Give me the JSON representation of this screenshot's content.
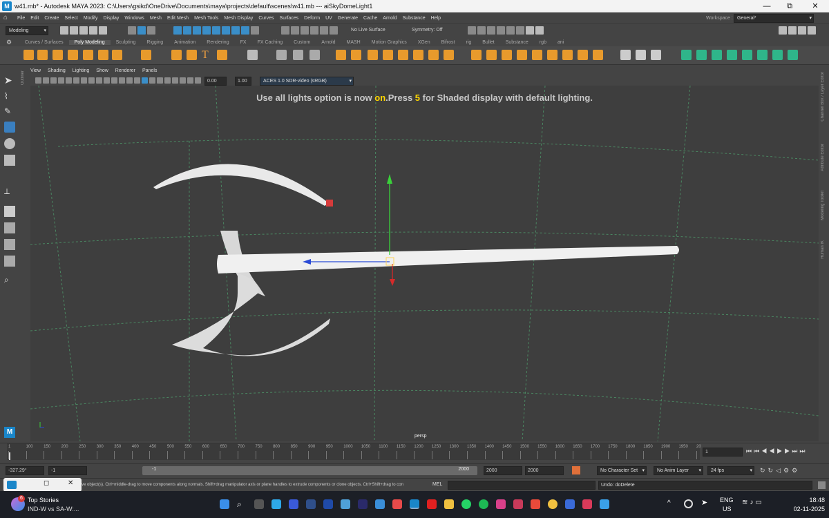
{
  "window": {
    "title": "w41.mb* - Autodesk MAYA 2023: C:\\Users\\gsikd\\OneDrive\\Documents\\maya\\projects\\default\\scenes\\w41.mb   ---   aiSkyDomeLight1",
    "minimize": "—",
    "maximize": "⧉",
    "close": "✕"
  },
  "menubar": {
    "items": [
      "File",
      "Edit",
      "Create",
      "Select",
      "Modify",
      "Display",
      "Windows",
      "Mesh",
      "Edit Mesh",
      "Mesh Tools",
      "Mesh Display",
      "Curves",
      "Surfaces",
      "Deform",
      "UV",
      "Generate",
      "Cache",
      "Arnold",
      "Substance",
      "Help"
    ],
    "workspace_label": "Workspace :",
    "workspace_value": "General*"
  },
  "statusline": {
    "menuset": "Modeling",
    "live_surface": "No Live Surface",
    "symmetry": "Symmetry: Off"
  },
  "shelf": {
    "tabs": [
      "Curves / Surfaces",
      "Poly Modeling",
      "Sculpting",
      "Rigging",
      "Animation",
      "Rendering",
      "FX",
      "FX Caching",
      "Custom",
      "Arnold",
      "MASH",
      "Motion Graphics",
      "XGen",
      "Bifrost",
      "rig",
      "Bullet",
      "Substance",
      "rgb",
      "ani"
    ],
    "active_tab": "Poly Modeling"
  },
  "panel": {
    "menus": [
      "View",
      "Shading",
      "Lighting",
      "Show",
      "Renderer",
      "Panels"
    ],
    "exposure": "0.00",
    "gamma": "1.00",
    "color_space": "ACES 1.0 SDR-video (sRGB)"
  },
  "viewport": {
    "hud_part1": "Use all lights option is now ",
    "hud_on": "on",
    "hud_part2": ".Press ",
    "hud_key": "5",
    "hud_part3": " for Shaded display with default lighting.",
    "camera": "persp"
  },
  "side_labels": {
    "outliner": "Outliner",
    "channel_box": "Channel Box / Layer Editor",
    "attribute_editor": "Attribute Editor",
    "modeling_toolkit": "Modeling Toolkit",
    "human_ik": "Human IK"
  },
  "timeline": {
    "ticks": [
      "1",
      "100",
      "150",
      "200",
      "250",
      "300",
      "350",
      "400",
      "450",
      "500",
      "550",
      "600",
      "650",
      "700",
      "750",
      "800",
      "850",
      "900",
      "950",
      "1000",
      "1050",
      "1100",
      "1150",
      "1200",
      "1250",
      "1300",
      "1350",
      "1400",
      "1450",
      "1500",
      "1550",
      "1600",
      "1650",
      "1700",
      "1750",
      "1800",
      "1850",
      "1900",
      "1950",
      "20"
    ],
    "current_frame": "1",
    "fps": "24 fps"
  },
  "range": {
    "time_field": "-327.29°",
    "start": "-1",
    "range_start": "-1",
    "range_end": "2000",
    "end1": "2000",
    "end2": "2000",
    "character_set": "No Character Set",
    "anim_layer": "No Anim Layer"
  },
  "helpline": {
    "text": "ve object(s). Ctrl+middle-drag to move components along normals. Shift+drag manipulator axis or plane handles to extrude components or clone objects. Ctrl+Shift+drag to con",
    "mel_label": "MEL",
    "undo": "Undo: doDelete"
  },
  "taskbar": {
    "news_badge": "6",
    "news_title": "Top Stories",
    "news_sub": "IND-W vs SA-W:...",
    "lang1": "ENG",
    "lang2": "US",
    "time": "18:48",
    "date": "02-11-2025"
  },
  "colors": {
    "maya_blue": "#1a86c9",
    "hud_yellow": "#ffd700",
    "grid": "#4fa06e"
  }
}
